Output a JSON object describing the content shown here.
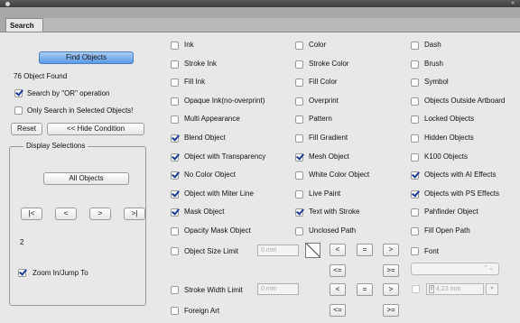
{
  "panel": {
    "tab_label": "Search",
    "menu_icon": "double-chevron-right-icon"
  },
  "left": {
    "find_button": "Find Objects",
    "result_text": "76 Object Found",
    "search_or": {
      "label": "Search by \"OR\" operation",
      "checked": true
    },
    "only_selected": {
      "label": "Only Search in Selected Objects!",
      "checked": false
    },
    "reset_button": "Reset",
    "hide_condition_button": "<< Hide Condition",
    "display_group_title": "Display Selections",
    "all_objects_button": "All Objects",
    "nav": {
      "first": "|<",
      "prev": "<",
      "next": ">",
      "last": ">|"
    },
    "counter": "2",
    "zoom": {
      "label": "Zoom In/Jump To",
      "checked": true
    }
  },
  "columns": {
    "col1": [
      {
        "label": "Ink",
        "checked": false
      },
      {
        "label": "Stroke Ink",
        "checked": false
      },
      {
        "label": "Fill Ink",
        "checked": false
      },
      {
        "label": "Opaque Ink(no-overprint)",
        "checked": false
      },
      {
        "label": "Multi Appearance",
        "checked": false
      },
      {
        "label": "Blend Object",
        "checked": true
      },
      {
        "label": "Object with Transparency",
        "checked": true
      },
      {
        "label": "No Color Object",
        "checked": true
      },
      {
        "label": "Object with Miter Line",
        "checked": true
      },
      {
        "label": "Mask Object",
        "checked": true
      },
      {
        "label": "Opacity Mask Object",
        "checked": false
      }
    ],
    "col2": [
      {
        "label": "Color",
        "checked": false
      },
      {
        "label": "Stroke Color",
        "checked": false
      },
      {
        "label": "Fill Color",
        "checked": false
      },
      {
        "label": "Overprint",
        "checked": false
      },
      {
        "label": "Pattern",
        "checked": false
      },
      {
        "label": "Fill Gradient",
        "checked": false
      },
      {
        "label": "Mesh Object",
        "checked": true
      },
      {
        "label": "White Color Object",
        "checked": false
      },
      {
        "label": "Live Paint",
        "checked": false
      },
      {
        "label": "Text with Stroke",
        "checked": true
      },
      {
        "label": "Unclosed Path",
        "checked": false
      }
    ],
    "col3": [
      {
        "label": "Dash",
        "checked": false
      },
      {
        "label": "Brush",
        "checked": false
      },
      {
        "label": "Symbol",
        "checked": false
      },
      {
        "label": "Objects Outside Artboard",
        "checked": false
      },
      {
        "label": "Locked Objects",
        "checked": false
      },
      {
        "label": "Hidden Objects",
        "checked": false
      },
      {
        "label": "K100 Objects",
        "checked": false
      },
      {
        "label": "Objects with AI Effects",
        "checked": true
      },
      {
        "label": "Objects with PS Effects",
        "checked": true
      },
      {
        "label": "Pahfinder Object",
        "checked": false
      },
      {
        "label": "Fill Open Path",
        "checked": false
      }
    ]
  },
  "size_limit": {
    "label": "Object Size Limit",
    "checked": false,
    "value": "0 mm"
  },
  "stroke_limit": {
    "label": "Stroke Width Limit",
    "checked": false,
    "value": "0 mm"
  },
  "foreign_art": {
    "label": "Foreign Art",
    "checked": false
  },
  "font": {
    "label": "Font",
    "checked": false,
    "size_value": "4,23 mm"
  },
  "compare": {
    "lt": "<",
    "eq": "=",
    "gt": ">",
    "le": "<=",
    "ge": ">="
  }
}
